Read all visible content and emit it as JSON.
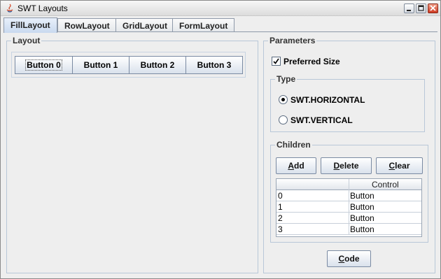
{
  "window": {
    "title": "SWT Layouts"
  },
  "tabs": [
    {
      "label": "FillLayout",
      "active": true
    },
    {
      "label": "RowLayout",
      "active": false
    },
    {
      "label": "GridLayout",
      "active": false
    },
    {
      "label": "FormLayout",
      "active": false
    }
  ],
  "layout_panel": {
    "title": "Layout",
    "buttons": [
      "Button 0",
      "Button 1",
      "Button 2",
      "Button 3"
    ]
  },
  "parameters": {
    "title": "Parameters",
    "preferred_size": {
      "label": "Preferred Size",
      "checked": true
    },
    "type": {
      "title": "Type",
      "options": [
        {
          "label": "SWT.HORIZONTAL",
          "selected": true
        },
        {
          "label": "SWT.VERTICAL",
          "selected": false
        }
      ]
    },
    "children": {
      "title": "Children",
      "add_label_first": "A",
      "add_label_rest": "dd",
      "delete_label_first": "D",
      "delete_label_rest": "elete",
      "clear_label_first": "C",
      "clear_label_rest": "lear",
      "table": {
        "columns": [
          "",
          "Control"
        ],
        "rows": [
          [
            "0",
            "Button"
          ],
          [
            "1",
            "Button"
          ],
          [
            "2",
            "Button"
          ],
          [
            "3",
            "Button"
          ]
        ]
      }
    },
    "code_label_first": "C",
    "code_label_rest": "ode"
  },
  "colors": {
    "accent": "#c9d9ef",
    "group_border": "#b8c7d8",
    "close": "#cf3a22"
  }
}
